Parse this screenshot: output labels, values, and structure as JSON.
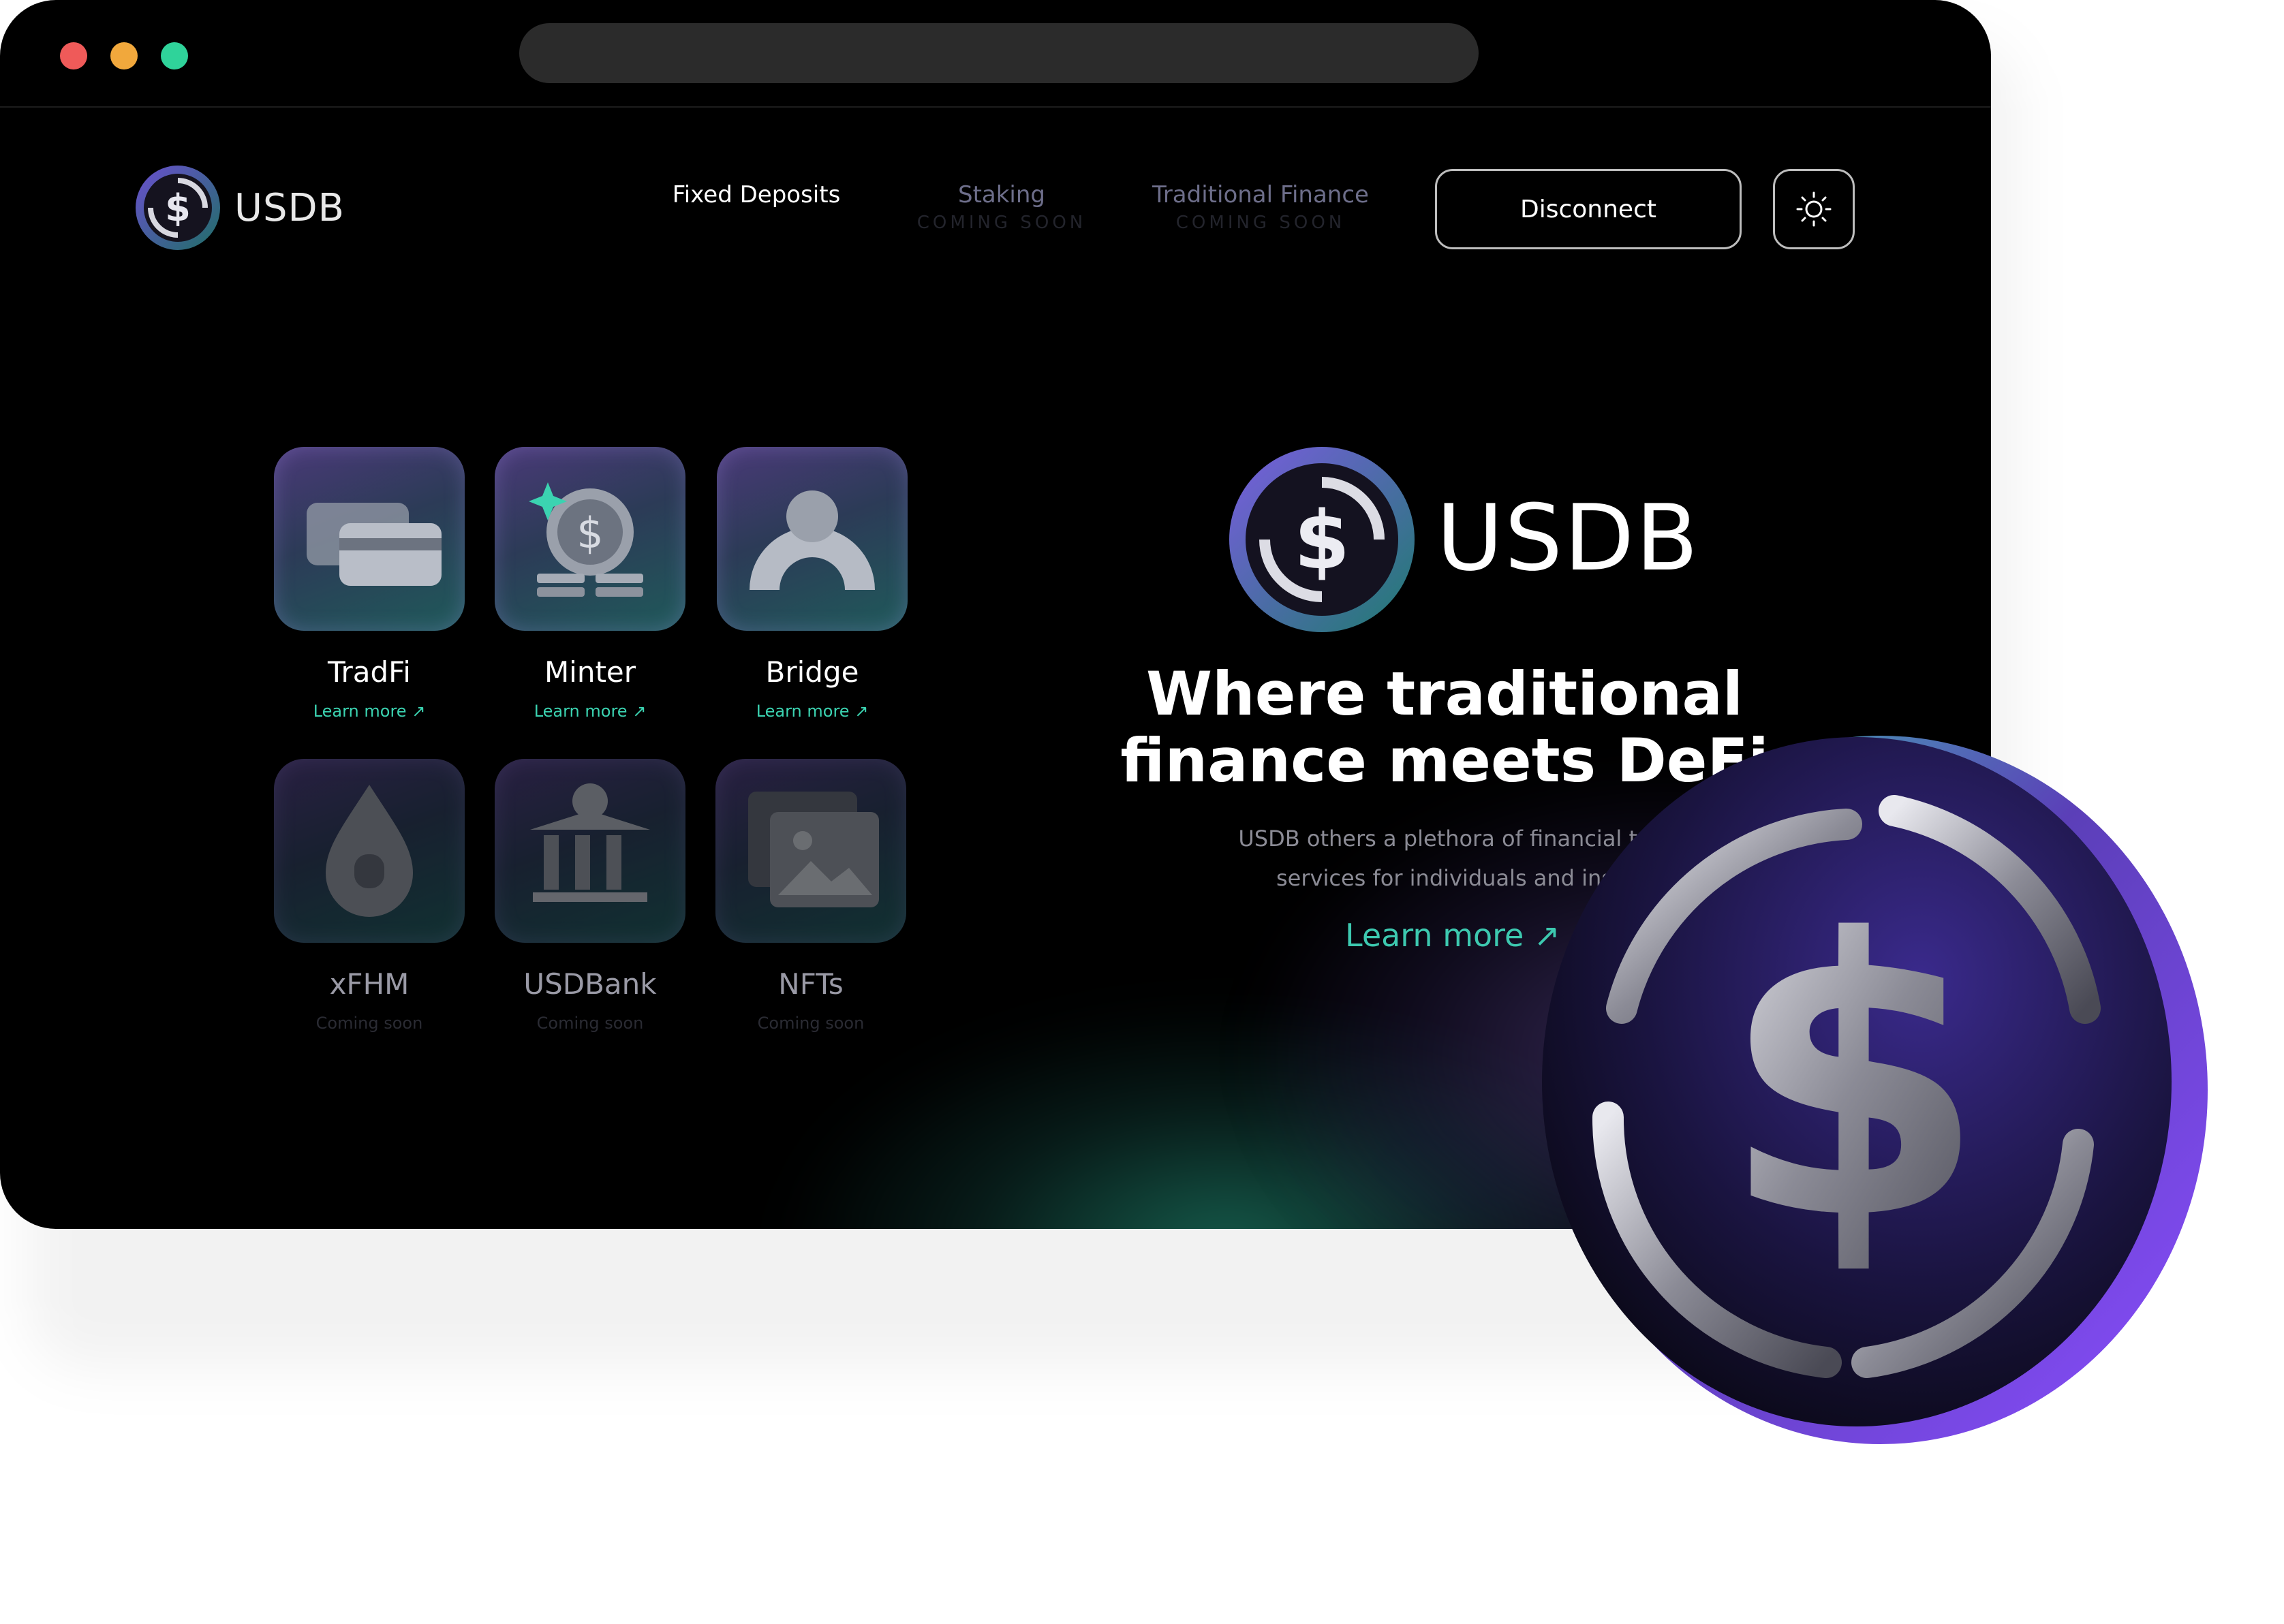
{
  "brand": {
    "name": "USDB"
  },
  "nav": {
    "items": [
      {
        "label": "Fixed Deposits",
        "sub": ""
      },
      {
        "label": "Staking",
        "sub": "COMING SOON"
      },
      {
        "label": "Traditional Finance",
        "sub": "COMING SOON"
      }
    ],
    "disconnect_label": "Disconnect",
    "theme_icon": "sun-icon"
  },
  "tiles": [
    {
      "name": "TradFi",
      "sub": "Learn more ↗",
      "icon": "cards-icon"
    },
    {
      "name": "Minter",
      "sub": "Learn more ↗",
      "icon": "coin-stack-icon"
    },
    {
      "name": "Bridge",
      "sub": "Learn more ↗",
      "icon": "bridge-icon"
    },
    {
      "name": "xFHM",
      "sub": "Coming soon",
      "icon": "drop-icon"
    },
    {
      "name": "USDBank",
      "sub": "Coming soon",
      "icon": "bank-icon"
    },
    {
      "name": "NFTs",
      "sub": "Coming soon",
      "icon": "image-icon"
    }
  ],
  "hero": {
    "logo_text": "USDB",
    "title_line1": "Where traditional",
    "title_line2": "finance meets DeFi",
    "subtitle_line1": "USDB others a plethora of financial to",
    "subtitle_line2": "services for individuals and ins",
    "cta": "Learn more ↗"
  },
  "colors": {
    "accent_teal": "#3bd3b1",
    "accent_purple": "#5b3fb8",
    "traffic_red": "#ef5a59",
    "traffic_yellow": "#f1a83c",
    "traffic_green": "#2fd39a"
  }
}
